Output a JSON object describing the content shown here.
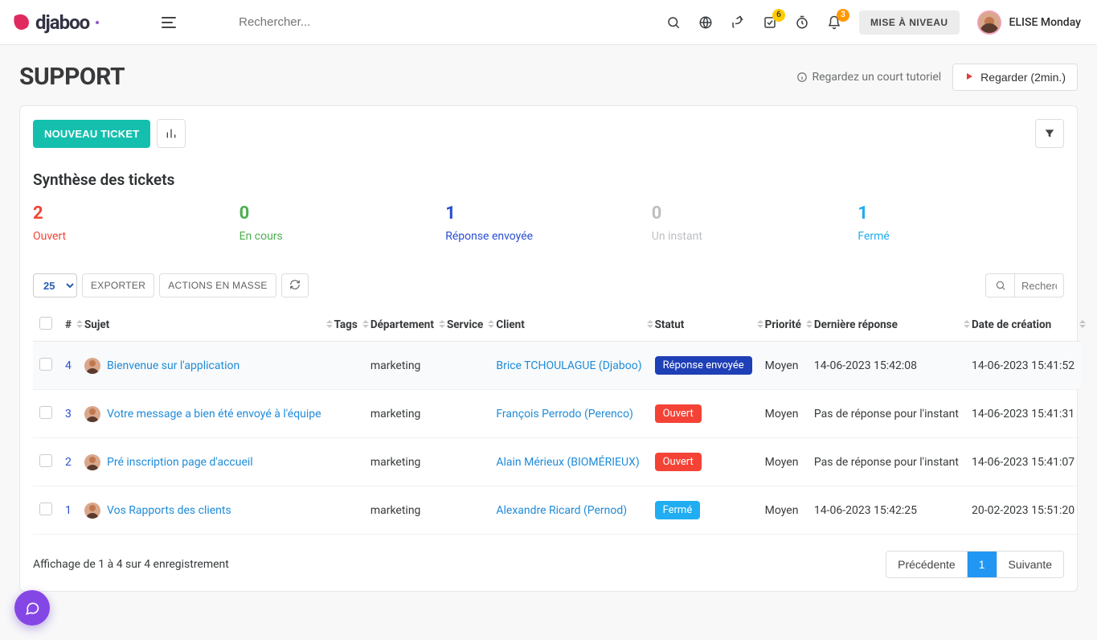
{
  "brand": "djaboo",
  "topbar": {
    "search_placeholder": "Rechercher...",
    "upgrade": "MISE À NIVEAU",
    "user_name": "ELISE Monday",
    "badge_check": "6",
    "badge_bell": "3"
  },
  "page": {
    "title": "SUPPORT",
    "hint": "Regardez un court tutoriel",
    "watch_btn": "Regarder (2min.)"
  },
  "toolbar": {
    "new_ticket": "NOUVEAU TICKET"
  },
  "summary": {
    "title": "Synthèse des tickets",
    "items": [
      {
        "num": "2",
        "label": "Ouvert"
      },
      {
        "num": "0",
        "label": "En cours"
      },
      {
        "num": "1",
        "label": "Réponse envoyée"
      },
      {
        "num": "0",
        "label": "Un instant"
      },
      {
        "num": "1",
        "label": "Fermé"
      }
    ]
  },
  "controls": {
    "page_size": "25",
    "export": "EXPORTER",
    "bulk": "ACTIONS EN MASSE",
    "search_placeholder": "Rechercher..."
  },
  "columns": {
    "num": "#",
    "subject": "Sujet",
    "tags": "Tags",
    "department": "Département",
    "service": "Service",
    "client": "Client",
    "status": "Statut",
    "priority": "Priorité",
    "last_reply": "Dernière réponse",
    "created": "Date de création"
  },
  "rows": [
    {
      "id": "4",
      "subject": "Bienvenue sur l'application",
      "department": "marketing",
      "client": "Brice TCHOULAGUE (Djaboo)",
      "status_label": "Réponse envoyée",
      "status_class": "pill-blue",
      "priority": "Moyen",
      "last_reply": "14-06-2023 15:42:08",
      "created": "14-06-2023 15:41:52"
    },
    {
      "id": "3",
      "subject": "Votre message a bien été envoyé à l'équipe",
      "department": "marketing",
      "client": "François Perrodo (Perenco)",
      "status_label": "Ouvert",
      "status_class": "pill-red",
      "priority": "Moyen",
      "last_reply": "Pas de réponse pour l'instant",
      "created": "14-06-2023 15:41:31"
    },
    {
      "id": "2",
      "subject": "Pré inscription page d'accueil",
      "department": "marketing",
      "client": "Alain Mérieux (BIOMÉRIEUX)",
      "status_label": "Ouvert",
      "status_class": "pill-red",
      "priority": "Moyen",
      "last_reply": "Pas de réponse pour l'instant",
      "created": "14-06-2023 15:41:07"
    },
    {
      "id": "1",
      "subject": "Vos Rapports des clients",
      "department": "marketing",
      "client": "Alexandre Ricard (Pernod)",
      "status_label": "Fermé",
      "status_class": "pill-sky",
      "priority": "Moyen",
      "last_reply": "14-06-2023 15:42:25",
      "created": "20-02-2023 15:51:20"
    }
  ],
  "footer": {
    "info": "Affichage de 1 à 4 sur 4 enregistrement",
    "prev": "Précédente",
    "page": "1",
    "next": "Suivante"
  }
}
